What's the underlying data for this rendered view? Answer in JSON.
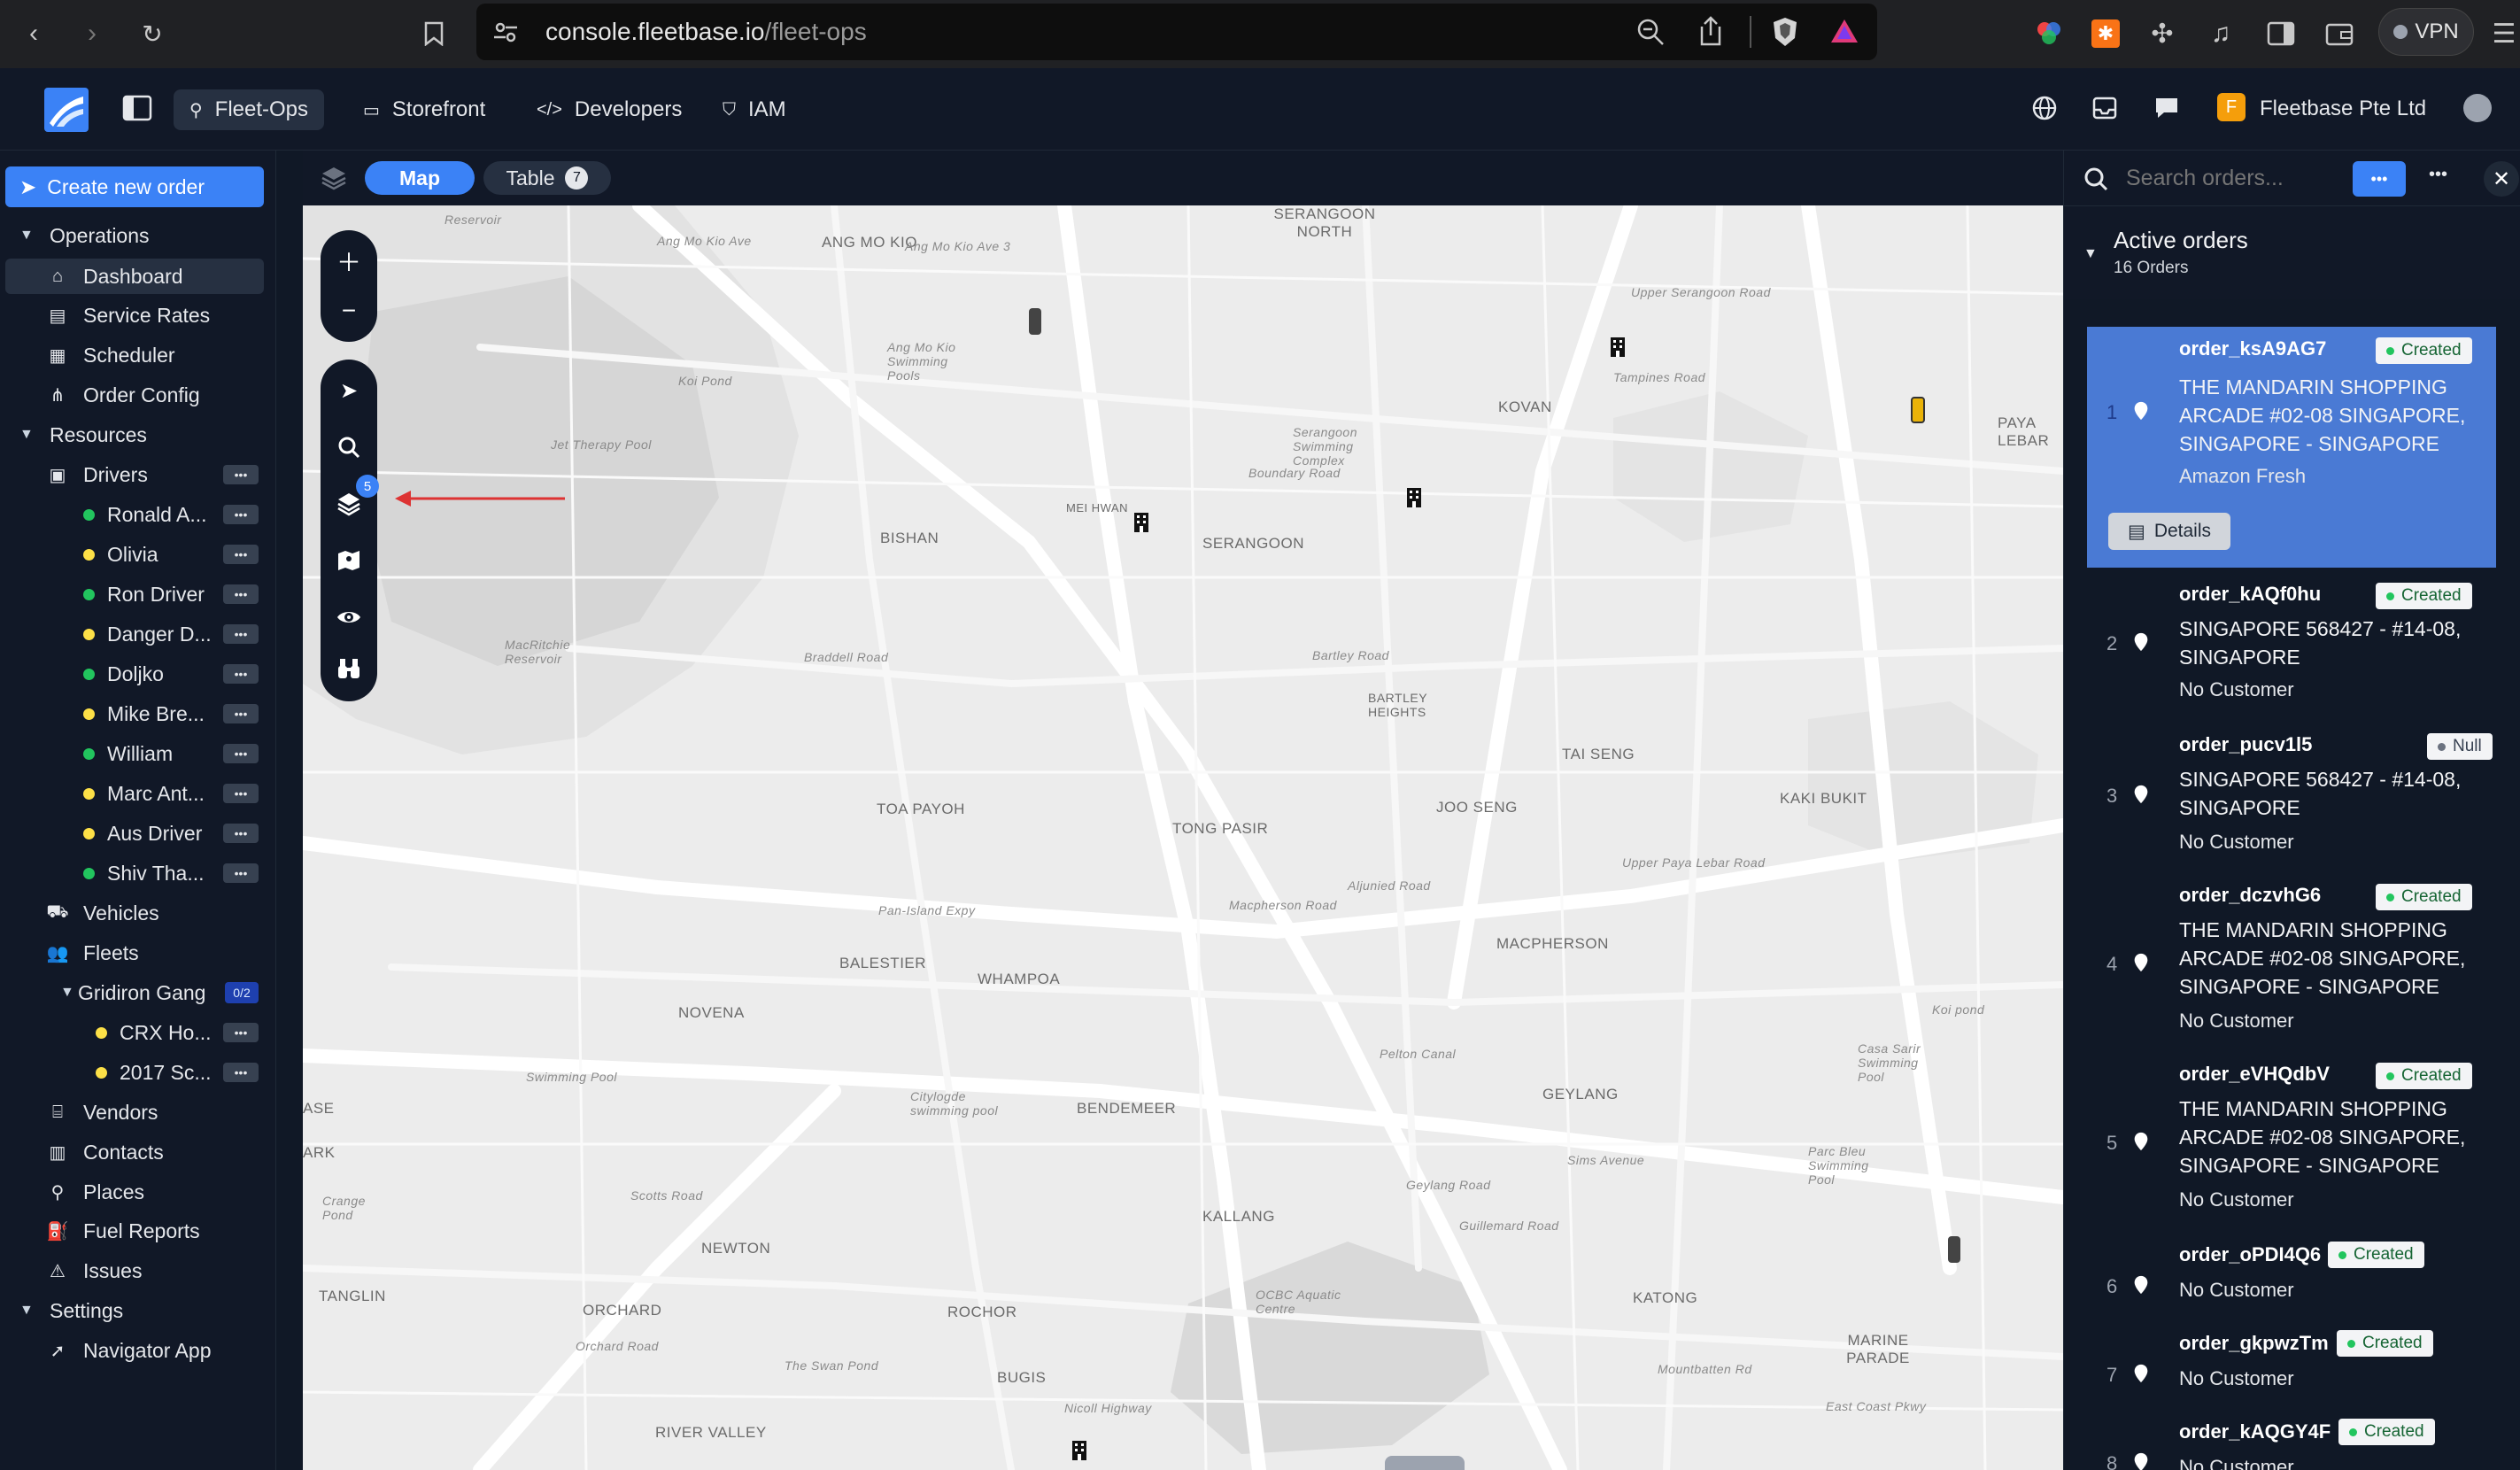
{
  "browser": {
    "url_host": "console.fleetbase.io",
    "url_path": "/fleet-ops",
    "vpn_label": "VPN"
  },
  "header": {
    "tabs": [
      {
        "label": "Fleet-Ops",
        "icon": "route-icon"
      },
      {
        "label": "Storefront",
        "icon": "store-icon"
      },
      {
        "label": "Developers",
        "icon": "code-icon"
      },
      {
        "label": "IAM",
        "icon": "shield-icon"
      }
    ],
    "org_initial": "F",
    "org_name": "Fleetbase Pte Ltd"
  },
  "sidebar": {
    "create_label": "Create new order",
    "operations": "Operations",
    "dashboard": "Dashboard",
    "service_rates": "Service Rates",
    "scheduler": "Scheduler",
    "order_config": "Order Config",
    "resources": "Resources",
    "drivers": "Drivers",
    "driver_list": [
      {
        "name": "Ronald A...",
        "status": "#22c55e"
      },
      {
        "name": "Olivia",
        "status": "#fde047"
      },
      {
        "name": "Ron Driver",
        "status": "#22c55e"
      },
      {
        "name": "Danger D...",
        "status": "#fde047"
      },
      {
        "name": "Doljko",
        "status": "#22c55e"
      },
      {
        "name": "Mike Bre...",
        "status": "#fde047"
      },
      {
        "name": "William",
        "status": "#22c55e"
      },
      {
        "name": "Marc Ant...",
        "status": "#fde047"
      },
      {
        "name": "Aus Driver",
        "status": "#fde047"
      },
      {
        "name": "Shiv Tha...",
        "status": "#22c55e"
      }
    ],
    "vehicles": "Vehicles",
    "fleets": "Fleets",
    "fleet_name": "Gridiron Gang",
    "fleet_badge": "0/2",
    "fleet_vehicles": [
      "CRX Ho...",
      "2017 Sc..."
    ],
    "vendors": "Vendors",
    "contacts": "Contacts",
    "places": "Places",
    "fuel_reports": "Fuel Reports",
    "issues": "Issues",
    "settings": "Settings",
    "navigator_app": "Navigator App"
  },
  "map_toolbar": {
    "map_label": "Map",
    "table_label": "Table",
    "table_count": "7"
  },
  "map": {
    "layers_badge": "5",
    "labels": [
      "ANG MO KIO",
      "SERANGOON NORTH",
      "KOVAN",
      "PAYA LEBAR",
      "BISHAN",
      "MEI HWAN",
      "SERANGOON",
      "BARTLEY HEIGHTS",
      "TAI SENG",
      "KAKI BUKIT",
      "TOA PAYOH",
      "TONG PASIR",
      "JOO SENG",
      "BALESTIER",
      "WHAMPOA",
      "MACPHERSON",
      "NOVENA",
      "BENDEMEER",
      "GEYLANG",
      "KALLANG",
      "NEWTON",
      "TANGLIN",
      "ORCHARD",
      "ROCHOR",
      "KATONG",
      "MARINE PARADE",
      "BUGIS",
      "RIVER VALLEY",
      "ASE",
      "ARK"
    ],
    "minor_labels": [
      "Ang Mo Kio Ave",
      "Ang Mo Kio Ave 3",
      "Jet Therapy Pool",
      "Koi Pond",
      "Ang Mo Kio Swimming Pools",
      "Serangoon Swimming Complex",
      "MacRitchie Reservoir",
      "Braddell Road",
      "Pan-Island Expy",
      "Swimming Pool",
      "Citylogde swimming pool",
      "Pelton Canal",
      "OCBC Aquatic Centre",
      "The Swan Pond",
      "Crange Pond",
      "Parc Bleu Swimming Pool",
      "Casa Sarir Swimming Pool",
      "Koi pond",
      "Sims Avenue",
      "Geylang Road",
      "Tampines Road",
      "Upper Serangoon Road",
      "Boundary Road",
      "Bartley Road",
      "Macpherson Road",
      "Aljunied Road",
      "Upper Paya Lebar Road",
      "Guillemard Road",
      "Mountbatten Rd",
      "East Coast Pkwy",
      "Nicoll Highway",
      "Scotts Road",
      "Orchard Road",
      "Reservoir"
    ]
  },
  "orders_panel": {
    "search_placeholder": "Search orders...",
    "title": "Active orders",
    "count": "16 Orders",
    "details_label": "Details",
    "orders": [
      {
        "num": "1",
        "id": "order_ksA9AG7",
        "status": "Created",
        "address": "THE MANDARIN SHOPPING ARCADE #02-08 SINGAPORE, SINGAPORE - SINGAPORE",
        "customer": "Amazon Fresh"
      },
      {
        "num": "2",
        "id": "order_kAQf0hu",
        "status": "Created",
        "address": "SINGAPORE 568427 - #14-08, SINGAPORE",
        "customer": "No Customer"
      },
      {
        "num": "3",
        "id": "order_pucv1l5",
        "status": "Null",
        "address": "SINGAPORE 568427 - #14-08, SINGAPORE",
        "customer": "No Customer"
      },
      {
        "num": "4",
        "id": "order_dczvhG6",
        "status": "Created",
        "address": "THE MANDARIN SHOPPING ARCADE #02-08 SINGAPORE, SINGAPORE - SINGAPORE",
        "customer": "No Customer"
      },
      {
        "num": "5",
        "id": "order_eVHQdbV",
        "status": "Created",
        "address": "THE MANDARIN SHOPPING ARCADE #02-08 SINGAPORE, SINGAPORE - SINGAPORE",
        "customer": "No Customer"
      },
      {
        "num": "6",
        "id": "order_oPDI4Q6",
        "status": "Created",
        "address": "",
        "customer": "No Customer"
      },
      {
        "num": "7",
        "id": "order_gkpwzTm",
        "status": "Created",
        "address": "",
        "customer": "No Customer"
      },
      {
        "num": "8",
        "id": "order_kAQGY4F",
        "status": "Created",
        "address": "",
        "customer": "No Customer"
      }
    ]
  }
}
